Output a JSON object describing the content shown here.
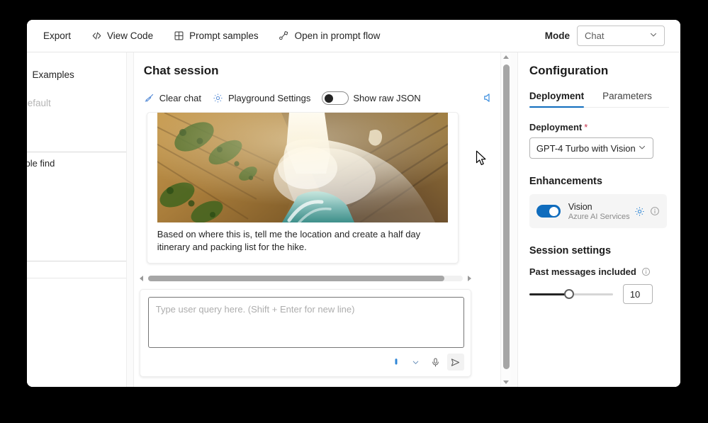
{
  "command_bar": {
    "items": [
      {
        "label": "Export",
        "icon": "none"
      },
      {
        "label": "View Code",
        "icon": "code-icon"
      },
      {
        "label": "Prompt samples",
        "icon": "grid-icon"
      },
      {
        "label": "Open in prompt flow",
        "icon": "flow-icon"
      }
    ],
    "mode_label": "Mode",
    "mode_value": "Chat",
    "mode_options": [
      "Chat"
    ]
  },
  "left_panel": {
    "tabs": [
      "a",
      "Examples"
    ],
    "subtext": "o default",
    "textarea_value": "eople find"
  },
  "chat": {
    "title": "Chat session",
    "toolbar": {
      "clear_chat": "Clear chat",
      "playground_settings": "Playground Settings",
      "show_raw_json": "Show raw JSON",
      "show_raw_json_on": false,
      "speaker_icon": "speaker-icon"
    },
    "message": {
      "image_alt": "aerial-view-of-waterfall",
      "text": "Based on where this is, tell me the location and create a half day itinerary and packing list for the hike."
    },
    "composer": {
      "placeholder": "Type user query here. (Shift + Enter for new line)",
      "value": "",
      "actions": [
        "attachment-icon",
        "chevron-down-icon",
        "microphone-icon",
        "send-icon"
      ]
    }
  },
  "config": {
    "title": "Configuration",
    "tabs": [
      {
        "label": "Deployment",
        "active": true
      },
      {
        "label": "Parameters",
        "active": false
      }
    ],
    "deployment": {
      "label": "Deployment",
      "required_mark": "*",
      "value": "GPT-4 Turbo with Vision",
      "options": [
        "GPT-4 Turbo with Vision"
      ]
    },
    "enhancements": {
      "heading": "Enhancements",
      "vision": {
        "title": "Vision",
        "subtitle": "Azure AI Services",
        "enabled": true,
        "gear_icon": "gear-icon",
        "info_icon": "info-icon"
      }
    },
    "session_settings": {
      "heading": "Session settings",
      "past_messages_label": "Past messages included",
      "past_messages_value": "10",
      "slider_min": 1,
      "slider_max": 20,
      "info_icon": "info-icon"
    }
  },
  "colors": {
    "accent": "#0f6cbd",
    "toolbar_icon": "#5b8fd8",
    "required": "#c4314b",
    "page_background": "#000000",
    "panel_background": "#ffffff"
  }
}
